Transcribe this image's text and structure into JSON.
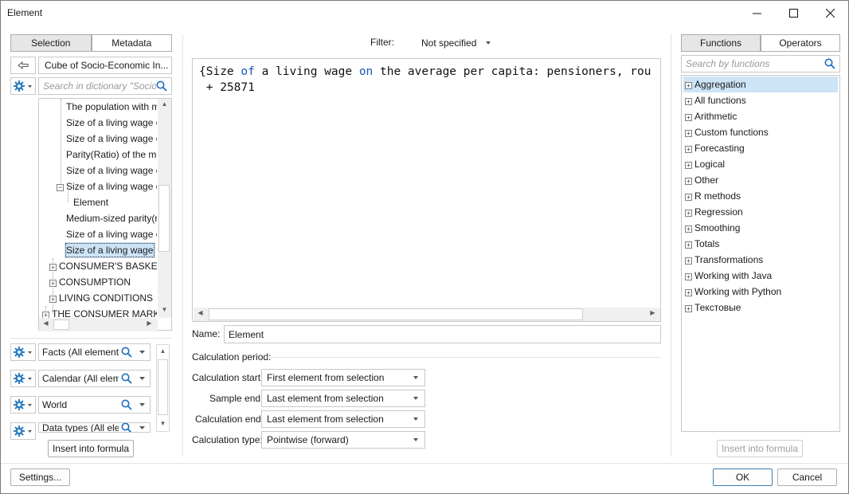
{
  "window": {
    "title": "Element",
    "minimize": "—",
    "maximize": "☐",
    "close": "✕"
  },
  "left_panel": {
    "tabs": [
      {
        "label": "Selection",
        "active": true
      },
      {
        "label": "Metadata",
        "active": false
      }
    ],
    "cube_label": "Cube of Socio-Economic In...",
    "search_placeholder": "Search in dictionary \"Socio...",
    "tree": [
      "The population with m",
      "Size of a living wage o",
      "Size of a living wage o",
      "Parity(Ratio) of the mo",
      "Size of a living wage o",
      "Size of a living wage o",
      "Element",
      "Medium-sized parity(ra",
      "Size of a living wage o",
      "Size of a living wage o",
      "CONSUMER'S BASKET",
      "CONSUMPTION",
      "LIVING CONDITIONS",
      "THE CONSUMER MARKET"
    ],
    "dimensions": [
      "Facts (All elements)",
      "Calendar (All elemen",
      "World",
      "Data types (All elem"
    ],
    "insert_button": "Insert into formula",
    "settings_button": "Settings..."
  },
  "center": {
    "filter_label": "Filter:",
    "filter_value": "Not specified",
    "formula_parts": {
      "p1": "{Size ",
      "kw1": "of",
      "p2": " a living wage ",
      "kw2": "on",
      "p3": " the average per capita: pensioners, rou",
      "line2": " + 25871"
    },
    "name_label": "Name:",
    "name_value": "Element",
    "calc_period_label": "Calculation period:",
    "rows": [
      {
        "label": "Calculation start:",
        "value": "First element from selection"
      },
      {
        "label": "Sample end:",
        "value": "Last element from selection"
      },
      {
        "label": "Calculation end:",
        "value": "Last element from selection"
      },
      {
        "label": "Calculation type:",
        "value": "Pointwise (forward)"
      }
    ]
  },
  "right_panel": {
    "tabs": [
      {
        "label": "Functions",
        "active": true
      },
      {
        "label": "Operators",
        "active": false
      }
    ],
    "search_placeholder": "Search by functions",
    "functions": [
      "Aggregation",
      "All functions",
      "Arithmetic",
      "Custom functions",
      "Forecasting",
      "Logical",
      "Other",
      "R methods",
      "Regression",
      "Smoothing",
      "Totals",
      "Transformations",
      "Working with Java",
      "Working with Python",
      "Текстовые"
    ],
    "insert_button": "Insert into formula"
  },
  "footer": {
    "ok": "OK",
    "cancel": "Cancel"
  },
  "colors": {
    "accent": "#1b6ec2",
    "selection": "#cde4f7",
    "keyword": "#1b58b8"
  }
}
